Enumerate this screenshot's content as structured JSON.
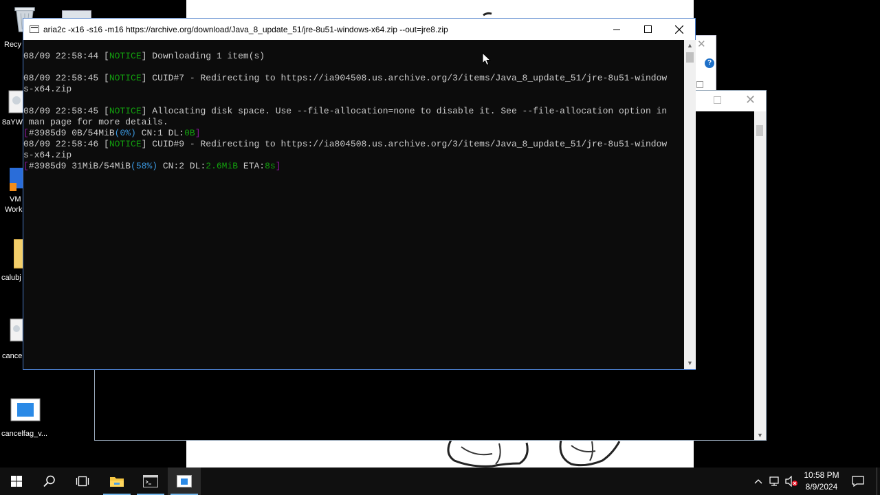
{
  "desktop": {
    "icons": [
      {
        "label": "Recy"
      },
      {
        "label": "8aYW"
      },
      {
        "label": "VM"
      },
      {
        "label": "Work"
      },
      {
        "label": "calubj"
      },
      {
        "label": "cance"
      },
      {
        "label": "cancelfag_v..."
      }
    ]
  },
  "console_window": {
    "title": "aria2c  -x16 -s16 -m16 https://archive.org/download/Java_8_update_51/jre-8u51-windows-x64.zip --out=jre8.zip",
    "lines": [
      {
        "ts": "08/09 22:58:44 ",
        "lb": "[",
        "tag": "NOTICE",
        "rb": "]",
        "msg": " Downloading 1 item(s)"
      },
      {
        "ts": "08/09 22:58:45 ",
        "lb": "[",
        "tag": "NOTICE",
        "rb": "]",
        "msg": " CUID#7 - Redirecting to https://ia904508.us.archive.org/3/items/Java_8_update_51/jre-8u51-window"
      },
      {
        "text": "s-x64.zip"
      },
      {
        "ts": "08/09 22:58:45 ",
        "lb": "[",
        "tag": "NOTICE",
        "rb": "]",
        "msg": " Allocating disk space. Use --file-allocation=none to disable it. See --file-allocation option in"
      },
      {
        "text": " man page for more details."
      },
      {
        "p1": "[",
        "p2": "#3985d9 0B/54MiB",
        "p3": "(0%)",
        "p4": " CN:1 DL:",
        "p5": "0B",
        "p6": "]"
      },
      {
        "ts": "08/09 22:58:46 ",
        "lb": "[",
        "tag": "NOTICE",
        "rb": "]",
        "msg": " CUID#9 - Redirecting to https://ia804508.us.archive.org/3/items/Java_8_update_51/jre-8u51-window"
      },
      {
        "text": "s-x64.zip"
      },
      {
        "p1": "[",
        "p2": "#3985d9 31MiB/54MiB",
        "p3": "(58%)",
        "p4": " CN:2 DL:",
        "p5": "2.6MiB",
        "p6": " ETA:",
        "p7": "8s",
        "p8": "]"
      }
    ]
  },
  "colors": {
    "notice": "#13a10e",
    "percent": "#3a96dd",
    "bracket": "#881798",
    "accent": "#76b9ed"
  },
  "taskbar": {
    "items": [
      "start-icon",
      "search-icon",
      "task-view-icon",
      "file-explorer-icon",
      "command-prompt-icon",
      "console-app-icon"
    ],
    "clock_time": "10:58 PM",
    "clock_date": "8/9/2024"
  }
}
